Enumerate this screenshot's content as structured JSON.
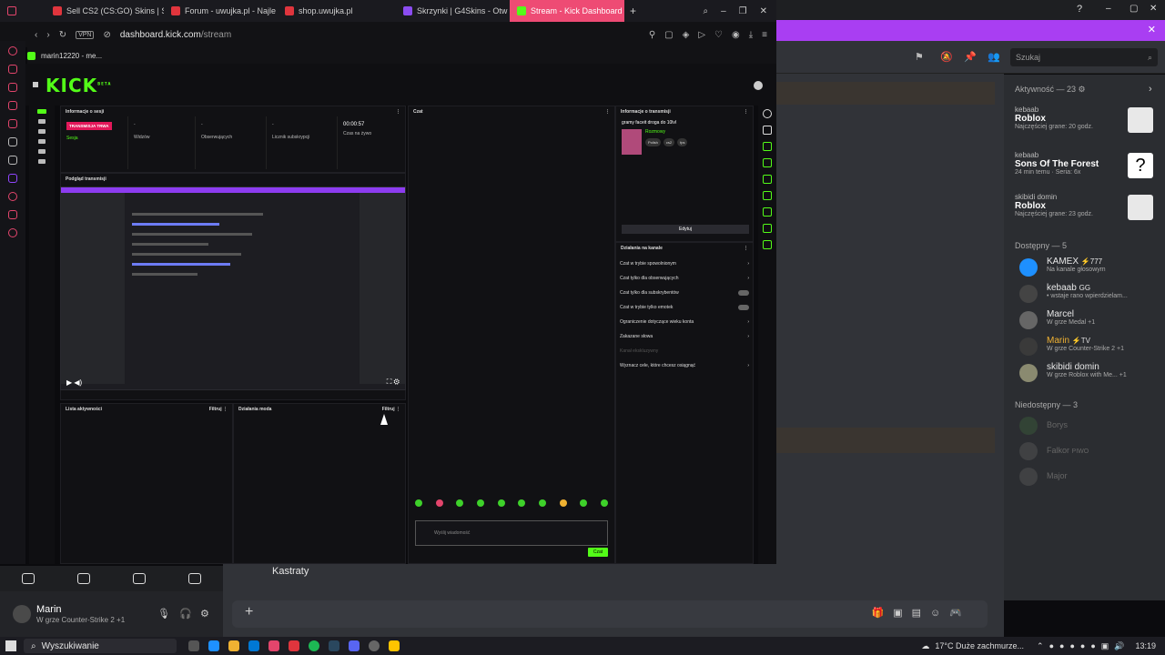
{
  "browser": {
    "tabs": [
      {
        "label": "Sell CS2 (CS:GO) Skins | S",
        "color": "#e0353d"
      },
      {
        "label": "Forum - uwujka.pl - Najle",
        "color": "#e0353d"
      },
      {
        "label": "shop.uwujka.pl",
        "color": "#e0353d"
      },
      {
        "label": "Skrzynki | G4Skins - Otw",
        "color": "#8b4cf0"
      },
      {
        "label": "Stream - Kick Dashboard",
        "color": "#53fc18"
      }
    ],
    "url_host": "dashboard.kick.com",
    "url_path": "/stream",
    "vpn_label": "VPN",
    "bookmark": "marin12220 - me..."
  },
  "kick": {
    "logo": "KICK",
    "beta": "BETA",
    "session_panel": {
      "title": "Informacje o sesji",
      "live_badge": "TRANSMISJA TRWA",
      "session_link": "Sesja",
      "stats": [
        {
          "value": "-",
          "label": "Widzów"
        },
        {
          "value": "-",
          "label": "Obserwujących"
        },
        {
          "value": "-",
          "label": "Licznik subskrypcji"
        },
        {
          "value": "00:00:57",
          "label": "Czas na żywo"
        }
      ]
    },
    "preview_panel": {
      "title": "Podgląd transmisji"
    },
    "chat_panel": {
      "title": "Czat",
      "placeholder": "Wyślij wiadomość",
      "send": "Czat"
    },
    "stream_info": {
      "title": "Informacje o transmisji",
      "stream_title": "gramy faceit droga do 10lvl",
      "category": "Rozmowy",
      "tags": [
        "Polish",
        "cs2",
        "fps"
      ],
      "edit_button": "Edytuj"
    },
    "channel_actions": {
      "title": "Działania na kanale",
      "items": [
        "Czat w trybie spowolnionym",
        "Czat tylko dla obserwujących",
        "Czat tylko dla subskrybentów",
        "Czat w trybie tylko emotek",
        "Ograniczenie dotyczące wieku konta",
        "Zakazane słowa",
        "Kanał ekskluzywny",
        "Wyznacz cele, które chcesz osiągnąć"
      ]
    },
    "activity_panel": {
      "title": "Lista aktywności",
      "filter": "Filtruj"
    },
    "mod_panel": {
      "title": "Działania moda",
      "filter": "Filtruj"
    }
  },
  "discord": {
    "search_placeholder": "Szukaj",
    "activity_header": "Aktywność — 23",
    "activity_cards": [
      {
        "user": "kebaab",
        "game": "Roblox",
        "detail": "Najczęściej grane: 20 godz."
      },
      {
        "user": "kebaab",
        "game": "Sons Of The Forest",
        "detail": "24 min temu · Seria: 6x"
      },
      {
        "user": "skibidi domin",
        "game": "Roblox",
        "detail": "Najczęściej grane: 23 godz."
      }
    ],
    "online_header": "Dostępny — 5",
    "online": [
      {
        "name": "KAMEX",
        "tag": "⚡777",
        "status": "Na kanale głosowym",
        "color": "#e8e8e8"
      },
      {
        "name": "kebaab",
        "tag": "GG",
        "status": "• wstaje rano wpierdzielam...",
        "color": "#e8e8e8"
      },
      {
        "name": "Marcel",
        "tag": "",
        "status": "W grze Medal +1",
        "color": "#e8e8e8"
      },
      {
        "name": "Marin",
        "tag": "⚡TV",
        "status": "W grze Counter-Strike 2 +1",
        "color": "#f0b232"
      },
      {
        "name": "skibidi domin",
        "tag": "",
        "status": "W grze Roblox with Me... +1",
        "color": "#e8e8e8"
      }
    ],
    "offline_header": "Niedostępny — 3",
    "offline": [
      {
        "name": "Borys",
        "tag": ""
      },
      {
        "name": "Falkor",
        "tag": "PIWO"
      },
      {
        "name": "Major",
        "tag": ""
      }
    ],
    "channel_label": "Kastraty",
    "user": {
      "name": "Marin",
      "status": "W grze Counter-Strike 2 +1"
    }
  },
  "taskbar": {
    "search": "Wyszukiwanie",
    "weather": "17°C  Duże zachmurze...",
    "time": "13:19"
  }
}
